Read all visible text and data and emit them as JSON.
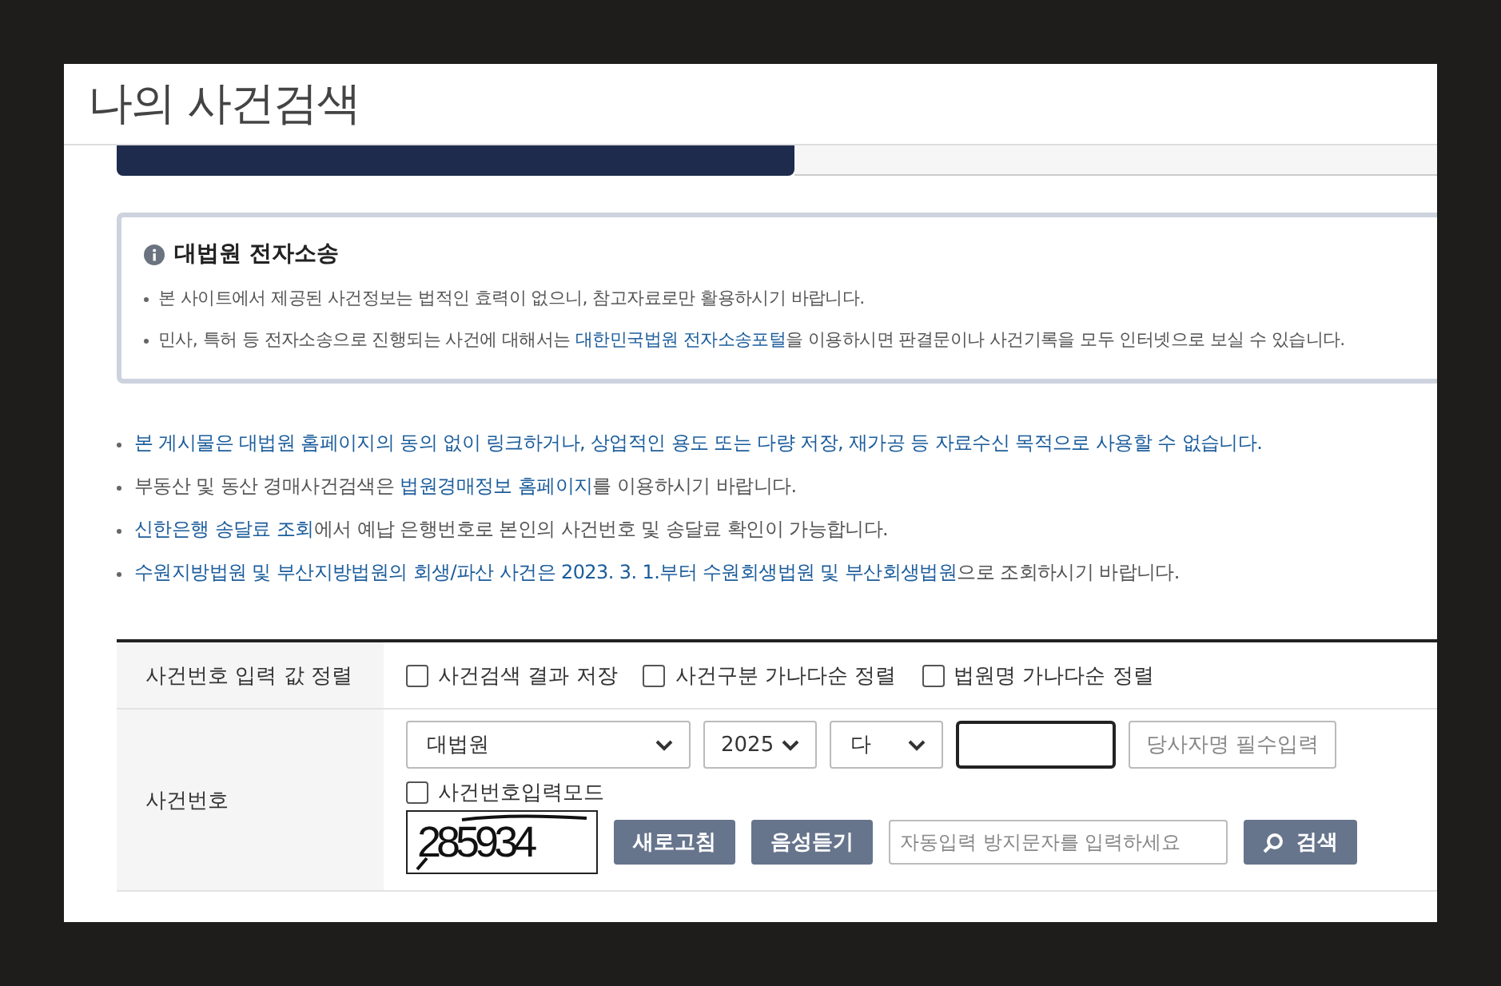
{
  "title": "나의 사건검색",
  "tabs": [
    {
      "selected": true
    },
    {
      "selected": false
    }
  ],
  "info": {
    "title": "대법원 전자소송",
    "items": [
      [
        {
          "text": "본 사이트에서 제공된 사건정보는 법적인 효력이 없으니, 참고자료로만 활용하시기 바랍니다."
        }
      ],
      [
        {
          "text": "민사, 특허 등 전자소송으로 진행되는 사건에 대해서는 "
        },
        {
          "text": "대한민국법원 전자소송포털",
          "link": true
        },
        {
          "text": "을 이용하시면 판결문이나 사건기록을 모두 인터넷으로 보실 수 있습니다."
        }
      ]
    ]
  },
  "notices": [
    [
      {
        "text": "본 게시물은 대법원 홈페이지의 동의 없이 링크하거나, 상업적인 용도 또는 다량 저장, 재가공 등 자료수신 목적으로 사용할 수 없습니다.",
        "link": true
      }
    ],
    [
      {
        "text": "부동산 및 동산 경매사건검색은 "
      },
      {
        "text": "법원경매정보 홈페이지",
        "link": true
      },
      {
        "text": "를 이용하시기 바랍니다."
      }
    ],
    [
      {
        "text": "신한은행 송달료 조회",
        "link": true
      },
      {
        "text": "에서 예납 은행번호로 본인의 사건번호 및 송달료 확인이 가능합니다."
      }
    ],
    [
      {
        "text": "수원지방법원 및 부산지방법원의 회생/파산 사건은 2023. 3. 1.부터 수원회생법원 및 부산회생법원",
        "link": true
      },
      {
        "text": "으로 조회하시기 바랍니다."
      }
    ]
  ],
  "form": {
    "sort_row": {
      "label": "사건번호 입력 값 정렬",
      "options": [
        {
          "label": "사건검색 결과 저장",
          "checked": false
        },
        {
          "label": "사건구분 가나다순 정렬",
          "checked": false
        },
        {
          "label": "법원명 가나다순 정렬",
          "checked": false
        }
      ]
    },
    "case_row": {
      "label": "사건번호",
      "court": "대법원",
      "year": "2025",
      "case_type": "다",
      "number_focused": true,
      "party_placeholder": "당사자명 필수입력",
      "input_mode": {
        "label": "사건번호입력모드",
        "checked": false
      },
      "captcha": "285934",
      "refresh_button": "새로고침",
      "audio_button": "음성듣기",
      "captcha_placeholder": "자동입력 방지문자를 입력하세요",
      "search_button": "검색"
    }
  }
}
